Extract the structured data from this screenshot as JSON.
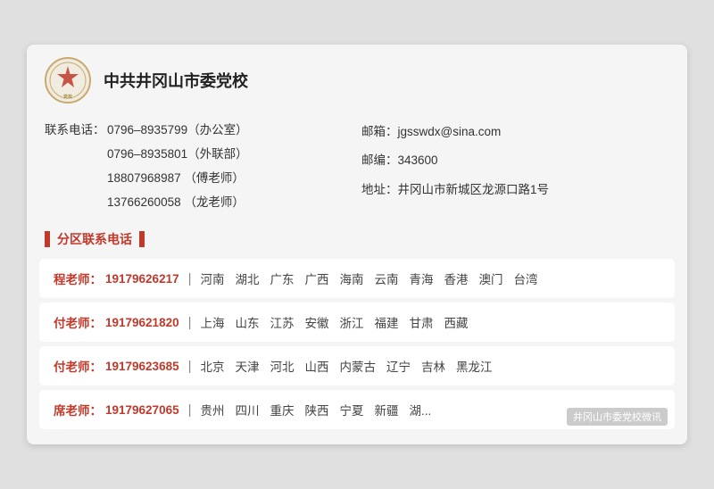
{
  "header": {
    "title": "中共井冈山市委党校",
    "logo_alt": "party-school-logo"
  },
  "contact": {
    "phone_label": "联系电话：",
    "phones": [
      {
        "number": "0796–8935799",
        "note": "（办公室）"
      },
      {
        "number": "0796–8935801",
        "note": "（外联部）"
      },
      {
        "number": "18807968987",
        "note": "  （傅老师）"
      },
      {
        "number": "13766260058",
        "note": "  （龙老师）"
      }
    ],
    "email_label": "邮箱：",
    "email": "jgsswdx@sina.com",
    "postcode_label": "邮编：",
    "postcode": "343600",
    "address_label": "地址：",
    "address": "井冈山市新城区龙源口路1号"
  },
  "section_title": "分区联系电话",
  "regions": [
    {
      "teacher": "程老师：",
      "phone": "19179626217",
      "areas": [
        "河南",
        "湖北",
        "广东",
        "广西",
        "海南",
        "云南",
        "青海",
        "香港",
        "澳门",
        "台湾"
      ]
    },
    {
      "teacher": "付老师：",
      "phone": "19179621820",
      "areas": [
        "上海",
        "山东",
        "江苏",
        "安徽",
        "浙江",
        "福建",
        "甘肃",
        "西藏"
      ]
    },
    {
      "teacher": "付老师：",
      "phone": "19179623685",
      "areas": [
        "北京",
        "天津",
        "河北",
        "山西",
        "内蒙古",
        "辽宁",
        "吉林",
        "黑龙江"
      ]
    },
    {
      "teacher": "席老师：",
      "phone": "19179627065",
      "areas": [
        "贵州",
        "四川",
        "重庆",
        "陕西",
        "宁夏",
        "新疆",
        "湖..."
      ],
      "watermark": "井冈山市委党校微讯"
    }
  ]
}
